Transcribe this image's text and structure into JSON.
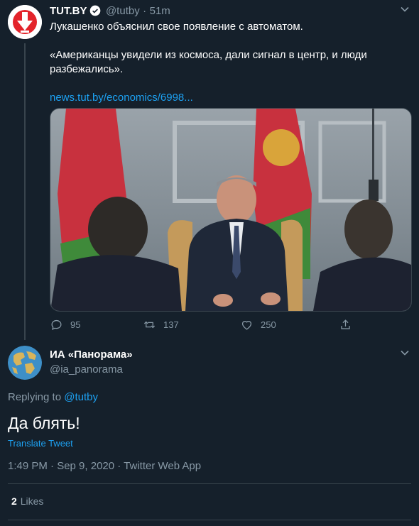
{
  "first_tweet": {
    "author_name": "TUT.BY",
    "handle": "@tutby",
    "separator": "·",
    "time": "51m",
    "text_line1": "Лукашенко объяснил свое появление с автоматом.",
    "text_line2": "«Американцы увидели из космоса, дали сигнал в центр, и люди",
    "text_line3": "разбежались».",
    "link": "news.tut.by/economics/6998...",
    "replies": "95",
    "retweets": "137",
    "likes": "250"
  },
  "second_tweet": {
    "author_name": "ИА «Панорама»",
    "handle": "@ia_panorama",
    "replying_prefix": "Replying to",
    "replying_handle": "@tutby",
    "text": "Да блять!",
    "translate": "Translate Tweet",
    "timestamp": "1:49 PM · Sep 9, 2020 · Twitter Web App",
    "likes_count": "2",
    "likes_label": "Likes"
  },
  "colors": {
    "background": "#15202b",
    "accent": "#1da1f2",
    "muted": "#8899a6",
    "divider": "#38444d"
  },
  "icons": [
    "tutby-logo-icon",
    "verified-icon",
    "chevron-down-icon",
    "reply-icon",
    "retweet-icon",
    "like-icon",
    "share-icon",
    "globe-avatar-icon"
  ]
}
